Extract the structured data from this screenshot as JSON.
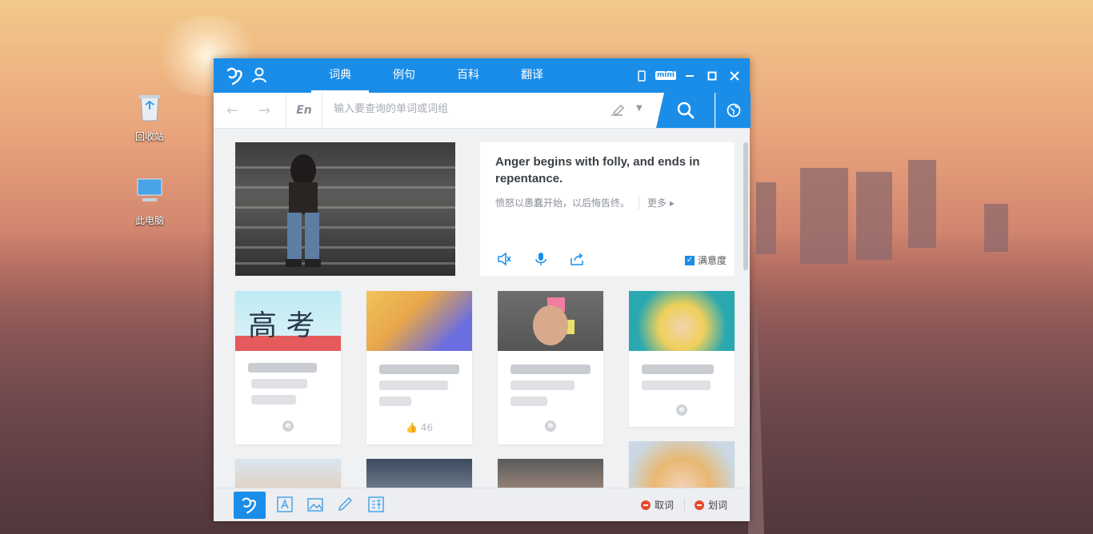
{
  "desktop": {
    "icons": [
      {
        "label": "回收站",
        "icon": "recycle-bin-icon"
      },
      {
        "label": "此电脑",
        "icon": "computer-icon"
      }
    ]
  },
  "app": {
    "tabs": [
      {
        "label": "词典",
        "active": true
      },
      {
        "label": "例句",
        "active": false
      },
      {
        "label": "百科",
        "active": false
      },
      {
        "label": "翻译",
        "active": false
      }
    ],
    "window_controls": {
      "mini_label": "mini"
    },
    "search": {
      "lang_label": "En",
      "placeholder": "输入要查询的单词或词组"
    },
    "quote": {
      "english": "Anger begins with folly, and ends in repentance.",
      "chinese": "愤怒以愚蠢开始，以后悔告终。",
      "more_label": "更多",
      "satisfaction_label": "满意度"
    },
    "cards": [
      {
        "meta": "e"
      },
      {
        "meta": "46"
      },
      {
        "meta": "e"
      },
      {
        "meta": "e"
      }
    ],
    "bottom": {
      "cancel_label": "取词",
      "stroke_label": "划词"
    },
    "colors": {
      "accent": "#1a8de9",
      "danger": "#e5492f"
    }
  }
}
